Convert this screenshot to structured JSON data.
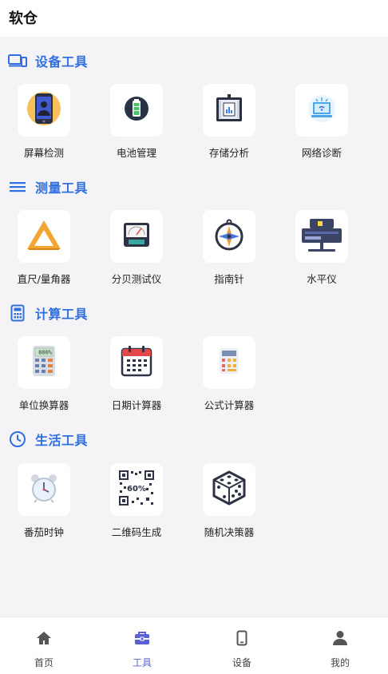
{
  "header": {
    "title": "软仓"
  },
  "sections": [
    {
      "title": "设备工具",
      "tools": [
        "屏幕检测",
        "电池管理",
        "存储分析",
        "网络诊断"
      ]
    },
    {
      "title": "测量工具",
      "tools": [
        "直尺/量角器",
        "分贝测试仪",
        "指南针",
        "水平仪"
      ]
    },
    {
      "title": "计算工具",
      "tools": [
        "单位换算器",
        "日期计算器",
        "公式计算器"
      ]
    },
    {
      "title": "生活工具",
      "tools": [
        "番茄时钟",
        "二维码生成",
        "随机决策器"
      ]
    }
  ],
  "icons": {
    "device": "devices-icon",
    "measure": "bars-icon",
    "compute": "calculator-icon",
    "life": "clock-icon",
    "screen": "phone-screen-icon",
    "battery": "battery-icon",
    "storage": "storage-server-icon",
    "network": "network-monitor-icon",
    "ruler": "triangle-ruler-icon",
    "decibel": "decibel-meter-icon",
    "compass": "compass-icon",
    "level": "spirit-level-icon",
    "unit": "converter-calculator-icon",
    "date": "calendar-icon",
    "formula": "formula-calculator-icon",
    "pomodoro": "alarm-clock-icon",
    "qrcode": "qr-code-icon",
    "random": "dice-icon"
  },
  "calc_display": "800%",
  "qr_text": "60%",
  "tabbar": {
    "items": [
      {
        "label": "首页",
        "icon": "home-icon"
      },
      {
        "label": "工具",
        "icon": "toolbox-icon",
        "active": true
      },
      {
        "label": "设备",
        "icon": "device-icon"
      },
      {
        "label": "我的",
        "icon": "user-icon"
      }
    ]
  },
  "colors": {
    "accent": "#2f6fdf",
    "tab_active": "#5a5fd6",
    "background": "#f4f4f6"
  }
}
